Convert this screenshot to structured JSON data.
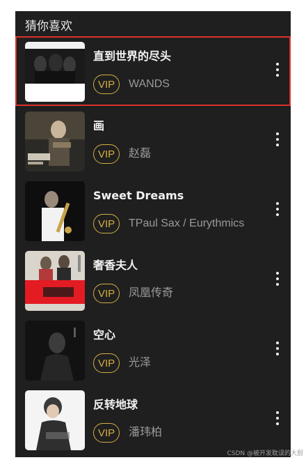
{
  "section": {
    "title": "猜你喜欢"
  },
  "songs": [
    {
      "title": "直到世界的尽头",
      "badge": "VIP",
      "artist": "WANDS",
      "selected": true
    },
    {
      "title": "画",
      "badge": "VIP",
      "artist": "赵磊",
      "selected": false
    },
    {
      "title": "Sweet Dreams",
      "badge": "VIP",
      "artist": "TPaul Sax / Eurythmics",
      "selected": false
    },
    {
      "title": "奢香夫人",
      "badge": "VIP",
      "artist": "凤凰传奇",
      "selected": false
    },
    {
      "title": "空心",
      "badge": "VIP",
      "artist": "光泽",
      "selected": false
    },
    {
      "title": "反转地球",
      "badge": "VIP",
      "artist": "潘玮柏",
      "selected": false
    }
  ],
  "colors": {
    "background": "#1f1f1f",
    "vip_gold": "#d4ad43",
    "selection_outline": "#d9322b"
  },
  "icons": {
    "more": "more-vertical-icon"
  },
  "footer": {
    "watermark": "CSDN @被开发耽误的大厨"
  }
}
